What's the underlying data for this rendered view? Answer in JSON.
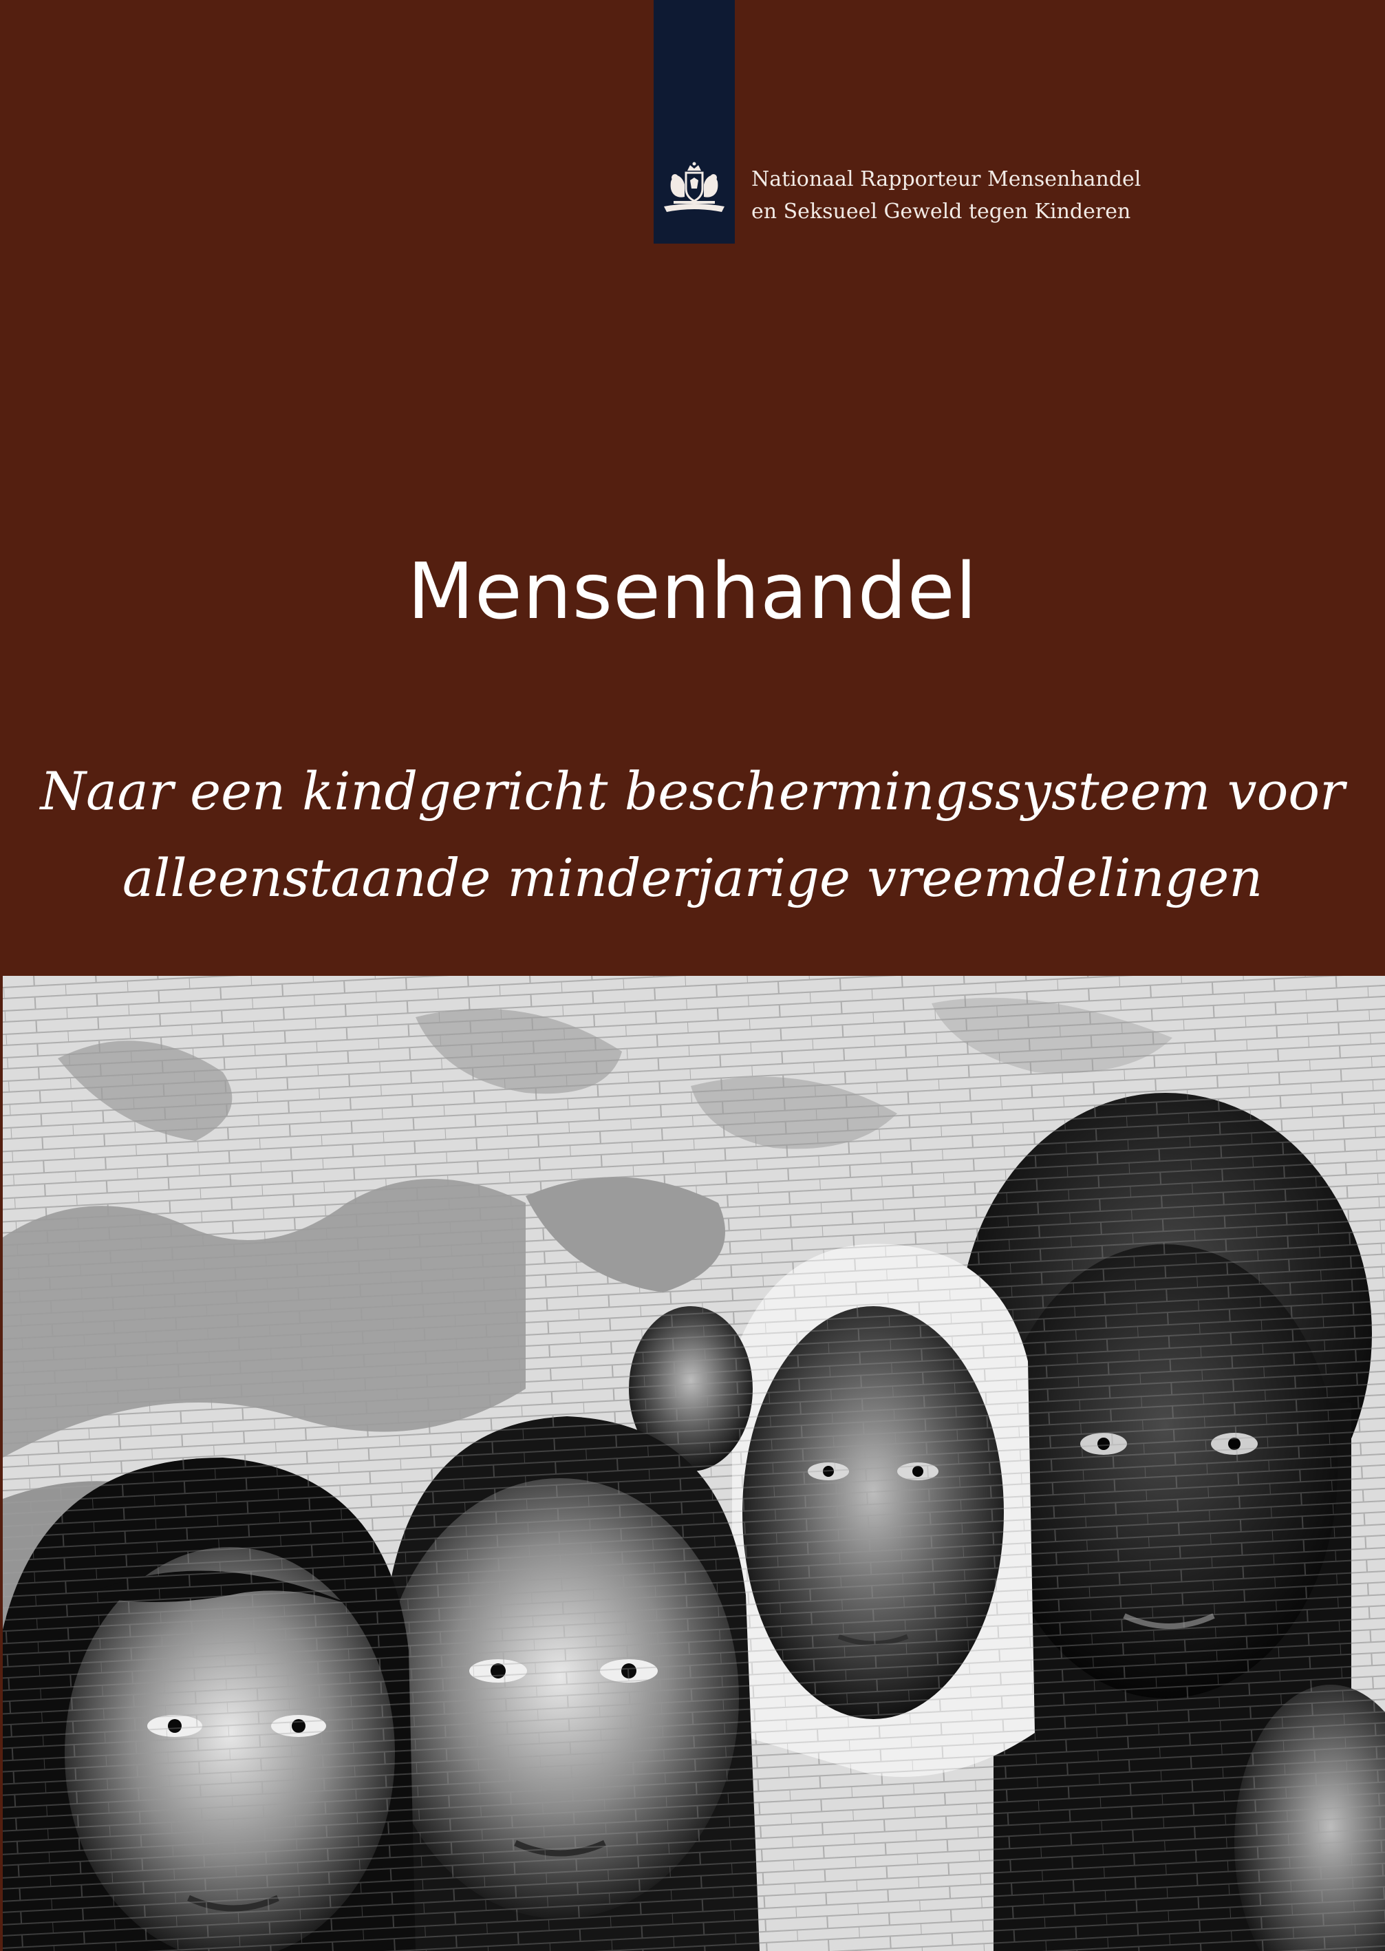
{
  "header": {
    "organization_line1": "Nationaal Rapporteur Mensenhandel",
    "organization_line2": "en Seksueel Geweld tegen Kinderen",
    "emblem_icon": "coat-of-arms-icon"
  },
  "cover": {
    "title": "Mensenhandel",
    "subtitle_line1": "Naar een kindgericht beschermingssysteem voor",
    "subtitle_line2": "alleenstaande minderjarige vreemdelingen"
  },
  "photo": {
    "description_icon": "mural-faces-photo"
  },
  "colors": {
    "background": "#541f10",
    "logo_strip": "#0e1a33",
    "text": "#ffffff"
  }
}
